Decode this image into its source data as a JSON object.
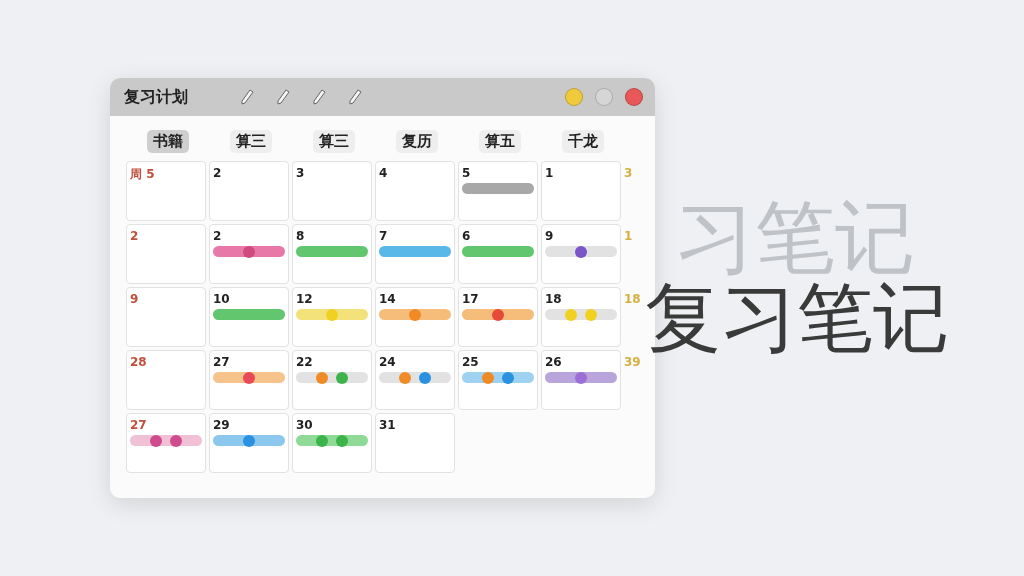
{
  "window": {
    "title": "复习计划"
  },
  "weekdays": [
    {
      "label": "书籍",
      "selected": true
    },
    {
      "label": "算三",
      "selected": false
    },
    {
      "label": "算三",
      "selected": false
    },
    {
      "label": "复历",
      "selected": false
    },
    {
      "label": "算五",
      "selected": false
    },
    {
      "label": "千龙",
      "selected": false
    }
  ],
  "weeks": [
    {
      "days": [
        {
          "date": "周 5"
        },
        {
          "date": "2"
        },
        {
          "date": "3"
        },
        {
          "date": "4"
        },
        {
          "date": "5",
          "events": [
            {
              "color": "#a8a8a8"
            }
          ]
        },
        {
          "date": "1"
        }
      ],
      "side": "3"
    },
    {
      "days": [
        {
          "date": "2"
        },
        {
          "date": "2",
          "events": [
            {
              "color": "#e878a8",
              "dots": [
                {
                  "color": "#d04a80"
                }
              ]
            }
          ]
        },
        {
          "date": "8",
          "events": [
            {
              "color": "#62c66e"
            }
          ]
        },
        {
          "date": "7",
          "events": [
            {
              "color": "#5ab8e8"
            }
          ]
        },
        {
          "date": "6",
          "events": [
            {
              "color": "#62c66e"
            }
          ]
        },
        {
          "date": "9",
          "events": [
            {
              "color": "#e2e2e2",
              "dots": [
                {
                  "color": "#7c55c8"
                }
              ]
            }
          ]
        }
      ],
      "side": "1"
    },
    {
      "days": [
        {
          "date": "9"
        },
        {
          "date": "10",
          "events": [
            {
              "color": "#62c66e"
            }
          ]
        },
        {
          "date": "12",
          "events": [
            {
              "color": "#f3e27a",
              "dots": [
                {
                  "color": "#f0d020"
                }
              ]
            }
          ]
        },
        {
          "date": "14",
          "events": [
            {
              "color": "#f6bd7a",
              "dots": [
                {
                  "color": "#f08a24"
                }
              ]
            }
          ]
        },
        {
          "date": "17",
          "events": [
            {
              "color": "#f6bd7a",
              "dots": [
                {
                  "color": "#e84a3a"
                }
              ]
            }
          ]
        },
        {
          "date": "18",
          "events": [
            {
              "color": "#e2e2e2",
              "dots": [
                {
                  "color": "#f0d020"
                },
                {
                  "color": "#f0d020"
                }
              ]
            }
          ]
        }
      ],
      "side": "18"
    },
    {
      "days": [
        {
          "date": "28"
        },
        {
          "date": "27",
          "events": [
            {
              "color": "#f6c48a",
              "dots": [
                {
                  "color": "#e84a5a"
                }
              ]
            }
          ]
        },
        {
          "date": "22",
          "events": [
            {
              "color": "#e2e2e2",
              "dots": [
                {
                  "color": "#f08a24"
                },
                {
                  "color": "#3cb44a"
                }
              ]
            }
          ]
        },
        {
          "date": "24",
          "events": [
            {
              "color": "#e2e2e2",
              "dots": [
                {
                  "color": "#f08a24"
                },
                {
                  "color": "#2a90e0"
                }
              ]
            }
          ]
        },
        {
          "date": "25",
          "events": [
            {
              "color": "#9fd2f0",
              "dots": [
                {
                  "color": "#f08a24"
                },
                {
                  "color": "#2a90e0"
                }
              ]
            }
          ]
        },
        {
          "date": "26",
          "events": [
            {
              "color": "#b9a4dc",
              "dots": [
                {
                  "color": "#9b6fd6"
                }
              ]
            }
          ]
        }
      ],
      "side": "39"
    },
    {
      "days": [
        {
          "date": "27",
          "events": [
            {
              "color": "#f0c0d4",
              "dots": [
                {
                  "color": "#d04a90"
                },
                {
                  "color": "#d04a90"
                }
              ]
            }
          ]
        },
        {
          "date": "29",
          "events": [
            {
              "color": "#8cc8ee",
              "dots": [
                {
                  "color": "#2a90e0"
                }
              ]
            }
          ]
        },
        {
          "date": "30",
          "events": [
            {
              "color": "#90da98",
              "dots": [
                {
                  "color": "#3cb44a"
                },
                {
                  "color": "#3cb44a"
                }
              ]
            }
          ]
        },
        {
          "date": "31"
        }
      ]
    }
  ],
  "headline": {
    "ghost": "习笔记",
    "title": "复习笔记"
  }
}
